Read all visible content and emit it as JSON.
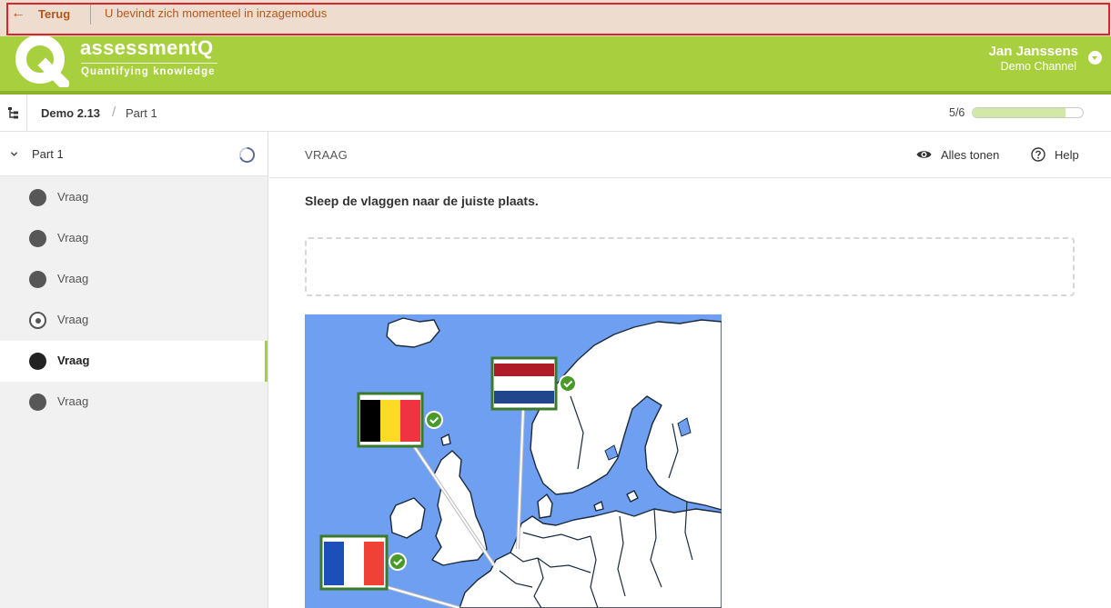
{
  "banner": {
    "back_label": "Terug",
    "message": "U bevindt zich momenteel in inzagemodus"
  },
  "header": {
    "brand": "assessmentQ",
    "tagline": "Quantifying knowledge",
    "user_name": "Jan Janssens",
    "user_channel": "Demo Channel"
  },
  "breadcrumb": {
    "items": [
      "Demo 2.13",
      "Part 1"
    ],
    "separator": "/"
  },
  "progress": {
    "text": "5/6",
    "fraction": 0.84
  },
  "sidebar": {
    "part_title": "Part 1",
    "questions": [
      {
        "label": "Vraag",
        "state": "answered"
      },
      {
        "label": "Vraag",
        "state": "answered"
      },
      {
        "label": "Vraag",
        "state": "answered"
      },
      {
        "label": "Vraag",
        "state": "partial"
      },
      {
        "label": "Vraag",
        "state": "current"
      },
      {
        "label": "Vraag",
        "state": "answered"
      }
    ]
  },
  "main": {
    "section_label": "VRAAG",
    "show_all_label": "Alles tonen",
    "help_label": "Help",
    "instruction": "Sleep de vlaggen naar de juiste plaats."
  },
  "map": {
    "flags": [
      {
        "country": "Netherlands",
        "colors": [
          "#ae1c28",
          "#ffffff",
          "#21468b"
        ],
        "correct": true
      },
      {
        "country": "Belgium",
        "colors": [
          "#000000",
          "#fdda24",
          "#ef3340"
        ],
        "correct": true
      },
      {
        "country": "France",
        "colors": [
          "#0055a4",
          "#ffffff",
          "#ef4135"
        ],
        "correct": true
      }
    ],
    "sea_color": "#6e9ff0",
    "land_color": "#ffffff",
    "frame_color": "#3b7a2b",
    "check_color": "#4a9a2a"
  },
  "colors": {
    "brand_green": "#a8cf3d",
    "banner_bg": "#eeddce",
    "banner_text": "#b3561c",
    "highlight_border": "#d8262d"
  }
}
